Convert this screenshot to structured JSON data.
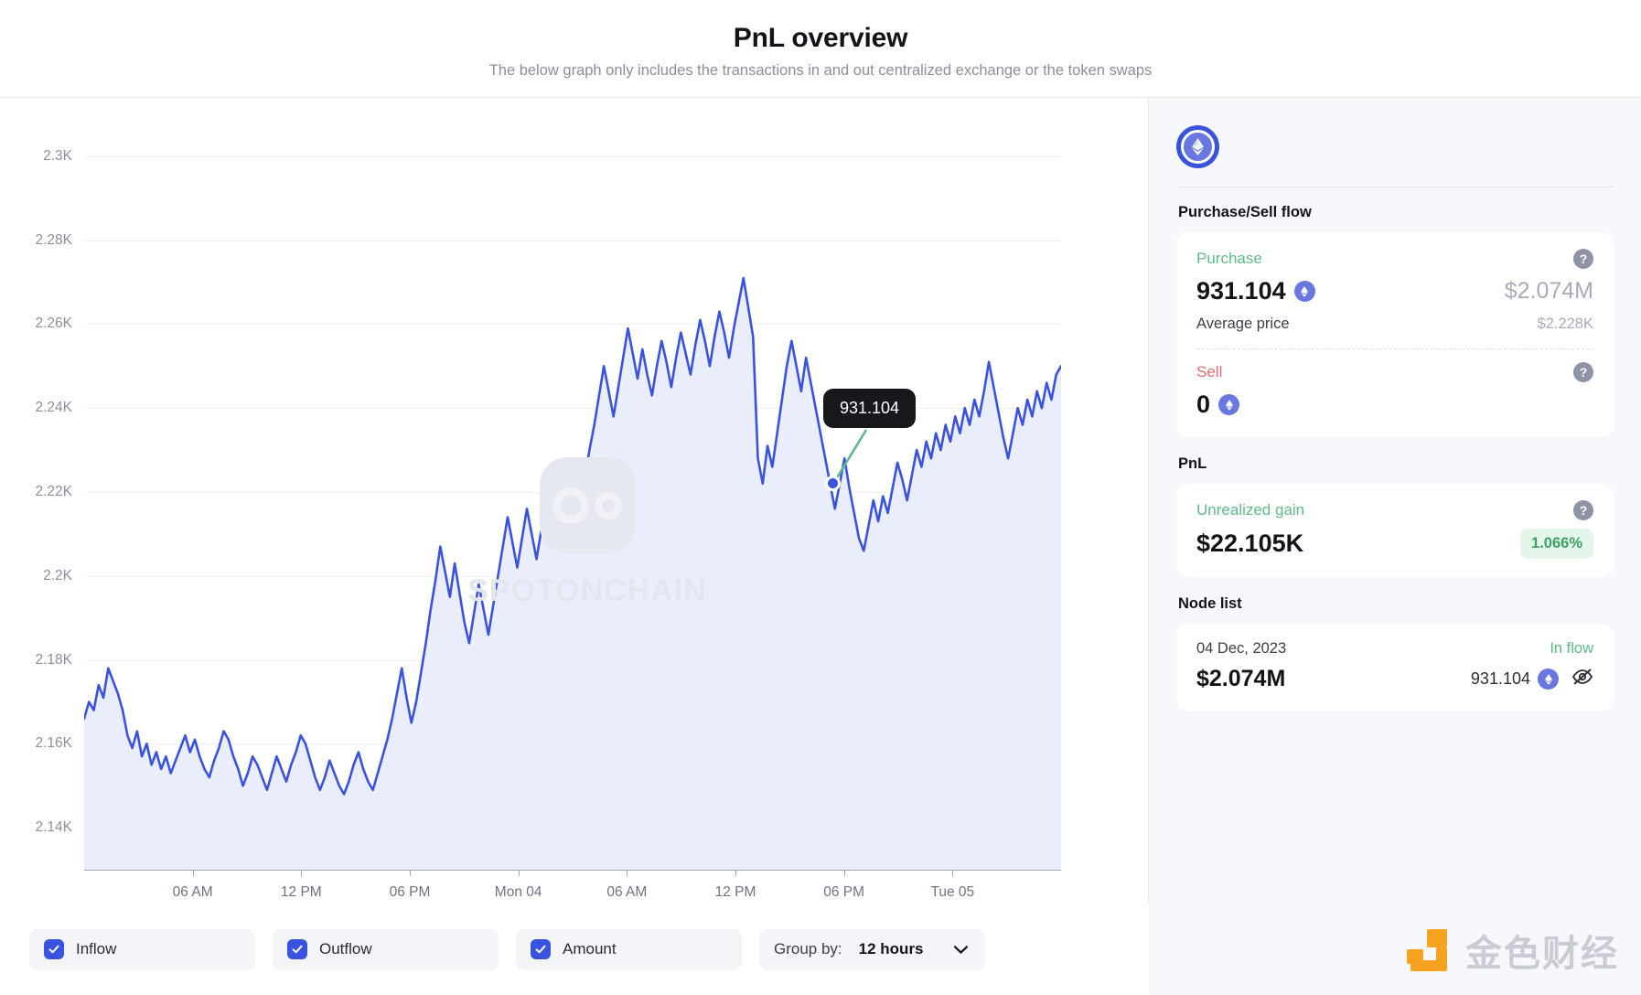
{
  "header": {
    "title": "PnL overview",
    "subtitle": "The below graph only includes the transactions in and out centralized exchange or the token swaps"
  },
  "chart_data": {
    "type": "line",
    "title": "PnL overview",
    "xlabel": "",
    "ylabel": "",
    "ylim": [
      2130,
      2310
    ],
    "grid": true,
    "ytick_labels": [
      "2.3K",
      "2.28K",
      "2.26K",
      "2.24K",
      "2.22K",
      "2.2K",
      "2.18K",
      "2.16K",
      "2.14K"
    ],
    "ytick_values": [
      2300,
      2280,
      2260,
      2240,
      2220,
      2200,
      2180,
      2160,
      2140
    ],
    "xtick_labels": [
      "06 AM",
      "12 PM",
      "06 PM",
      "Mon 04",
      "06 AM",
      "12 PM",
      "06 PM",
      "Tue 05"
    ],
    "series": [
      {
        "name": "Amount",
        "color": "#3a53de",
        "fill": "#eaeefc",
        "values": [
          2166,
          2170,
          2168,
          2174,
          2171,
          2178,
          2175,
          2172,
          2168,
          2162,
          2159,
          2163,
          2157,
          2160,
          2155,
          2158,
          2154,
          2157,
          2153,
          2156,
          2159,
          2162,
          2158,
          2161,
          2157,
          2154,
          2152,
          2156,
          2159,
          2163,
          2161,
          2157,
          2154,
          2150,
          2153,
          2157,
          2155,
          2152,
          2149,
          2153,
          2157,
          2154,
          2151,
          2155,
          2158,
          2162,
          2160,
          2156,
          2152,
          2149,
          2152,
          2156,
          2153,
          2150,
          2148,
          2151,
          2155,
          2158,
          2154,
          2151,
          2149,
          2153,
          2157,
          2161,
          2166,
          2172,
          2178,
          2171,
          2165,
          2170,
          2177,
          2184,
          2192,
          2199,
          2207,
          2201,
          2195,
          2203,
          2196,
          2189,
          2184,
          2191,
          2198,
          2192,
          2186,
          2193,
          2200,
          2207,
          2214,
          2208,
          2202,
          2209,
          2216,
          2210,
          2204,
          2211,
          2218,
          2224,
          2219,
          2213,
          2220,
          2227,
          2222,
          2216,
          2223,
          2230,
          2236,
          2243,
          2250,
          2244,
          2238,
          2245,
          2252,
          2259,
          2253,
          2247,
          2254,
          2248,
          2243,
          2250,
          2256,
          2251,
          2245,
          2252,
          2258,
          2253,
          2248,
          2255,
          2261,
          2256,
          2250,
          2257,
          2263,
          2258,
          2252,
          2259,
          2265,
          2271,
          2264,
          2257,
          2228,
          2222,
          2231,
          2226,
          2234,
          2242,
          2250,
          2256,
          2250,
          2244,
          2252,
          2246,
          2240,
          2234,
          2228,
          2222,
          2216,
          2222,
          2228,
          2221,
          2215,
          2209,
          2206,
          2212,
          2218,
          2213,
          2219,
          2215,
          2221,
          2227,
          2223,
          2218,
          2224,
          2230,
          2226,
          2232,
          2228,
          2234,
          2230,
          2236,
          2232,
          2238,
          2234,
          2240,
          2236,
          2242,
          2238,
          2244,
          2251,
          2245,
          2239,
          2233,
          2228,
          2234,
          2240,
          2236,
          2242,
          2238,
          2244,
          2240,
          2246,
          2242,
          2248,
          2250
        ]
      }
    ],
    "annotation": {
      "label": "931.104",
      "connector_color": "#5fba8a",
      "point_color": "#3a53de"
    },
    "watermark": "SPOTONCHAIN"
  },
  "toolbar": {
    "inflow_label": "Inflow",
    "inflow_checked": true,
    "outflow_label": "Outflow",
    "outflow_checked": true,
    "amount_label": "Amount",
    "amount_checked": true,
    "group_by_label": "Group by:",
    "group_by_value": "12 hours"
  },
  "sidebar": {
    "token_icon": "ethereum-icon",
    "purchase_sell": {
      "section_title": "Purchase/Sell flow",
      "purchase_label": "Purchase",
      "purchase_amount": "931.104",
      "purchase_usd": "$2.074M",
      "average_price_label": "Average price",
      "average_price_value": "$2.228K",
      "sell_label": "Sell",
      "sell_amount": "0"
    },
    "pnl": {
      "section_title": "PnL",
      "unrealized_label": "Unrealized gain",
      "unrealized_value": "$22.105K",
      "unrealized_pct": "1.066%"
    },
    "node_list": {
      "section_title": "Node list",
      "rows": [
        {
          "date": "04 Dec, 2023",
          "flow_label": "In flow",
          "usd": "$2.074M",
          "qty": "931.104"
        }
      ]
    }
  },
  "brand": {
    "name": "金色财经",
    "accent": "#f5a221"
  },
  "colors": {
    "accent": "#3a53de",
    "positive": "#5fba8a",
    "negative": "#e06b73",
    "muted": "#8b8f9c",
    "sidebar_bg": "#f7f8fb"
  }
}
